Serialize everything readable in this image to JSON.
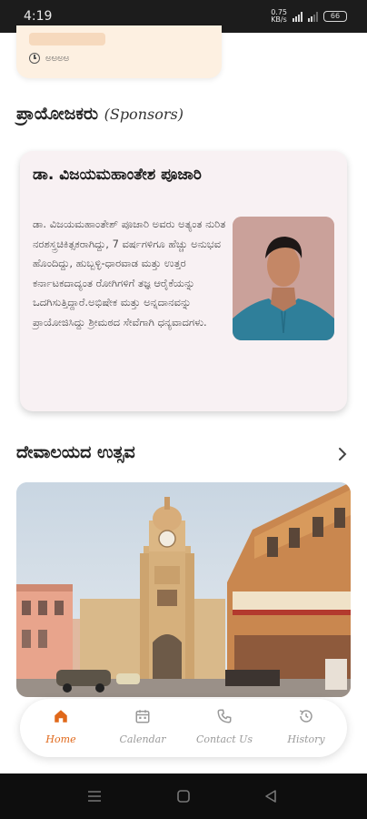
{
  "status_bar": {
    "time": "4:19",
    "speed": "0.75",
    "speed_unit": "KB/s",
    "battery": "66"
  },
  "event_card": {
    "time_text": "ಅಅಅಅ"
  },
  "sponsors": {
    "title_kn": "ಪ್ರಾಯೋಜಕರು",
    "title_en": "(Sponsors)",
    "name": "ಡಾ. ವಿಜಯಮಹಾಂತೇಶ ಪೂಜಾರಿ",
    "description": "ಡಾ. ವಿಜಯಮಹಾಂತೇಶ್ ಪೂಜಾರಿ ಅವರು ಅತ್ಯಂತ ನುರಿತ ನರಶಸ್ತ್ರಚಿಕಿತ್ಸಕರಾಗಿದ್ದು, 7 ವರ್ಷಗಳಿಗೂ ಹೆಚ್ಚು ಅನುಭವ ಹೊಂದಿದ್ದು, ಹುಬ್ಬಳ್ಳಿ-ಧಾರವಾಡ ಮತ್ತು ಉತ್ತರ ಕರ್ನಾಟಕದಾದ್ಯಂತ ರೋಗಿಗಳಿಗೆ ತಜ್ಞ ಆರೈಕೆಯನ್ನು ಒದಗಿಸುತ್ತಿದ್ದಾರೆ.ಅಭಿಷೇಕ ಮತ್ತು ಅನ್ನದಾನವನ್ನು ಪ್ರಾಯೋಜಿಸಿದ್ದು ಶ್ರೀಮಠದ ಸೇವೆಗಾಗಿ ಧನ್ಯವಾದಗಳು."
  },
  "festival": {
    "title": "ದೇವಾಲಯದ ಉತ್ಸವ"
  },
  "bottom_nav": {
    "items": [
      {
        "label": "Home",
        "icon": "home-icon"
      },
      {
        "label": "Calendar",
        "icon": "calendar-icon"
      },
      {
        "label": "Contact Us",
        "icon": "phone-icon"
      },
      {
        "label": "History",
        "icon": "history-icon"
      }
    ]
  },
  "colors": {
    "accent": "#e0681a",
    "card_bg": "#f8f1f3",
    "event_bg": "#fdf0e1"
  }
}
